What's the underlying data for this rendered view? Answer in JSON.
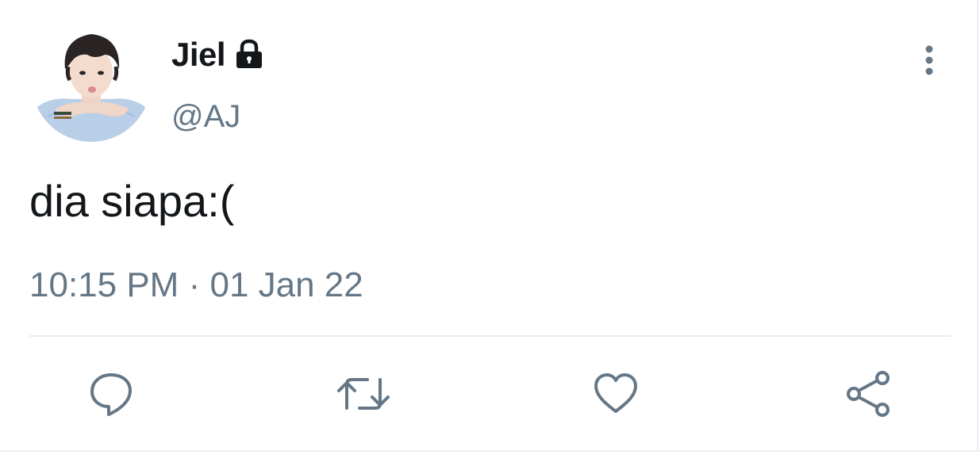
{
  "user": {
    "display_name": "Jiel",
    "handle": "@AJ",
    "protected_icon": "lock-icon",
    "avatar": "profile-photo"
  },
  "tweet": {
    "text": "dia siapa:(",
    "time": "10:15 PM",
    "separator": "·",
    "date": "01 Jan 22"
  },
  "actions": {
    "reply_icon": "reply-icon",
    "retweet_icon": "retweet-icon",
    "like_icon": "heart-icon",
    "share_icon": "share-icon"
  },
  "menu": {
    "more_icon": "vertical-dots-icon"
  },
  "colors": {
    "primary_text": "#14171a",
    "secondary_text": "#657786",
    "divider": "#e6ecf0",
    "icon": "#657786"
  }
}
